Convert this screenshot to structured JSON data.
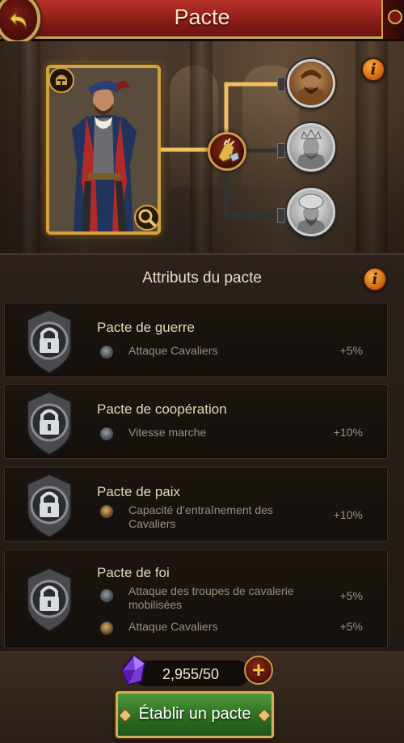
{
  "header": {
    "title": "Pacte"
  },
  "section": {
    "title": "Attributs du pacte"
  },
  "pacts": [
    {
      "name": "Pacte de guerre",
      "bonuses": [
        {
          "icon": "knight-helmet-icon",
          "label": "Attaque Cavaliers",
          "value": "+5%"
        }
      ]
    },
    {
      "name": "Pacte de coopération",
      "bonuses": [
        {
          "icon": "knight-helmet-icon",
          "label": "Vitesse marche",
          "value": "+10%"
        }
      ]
    },
    {
      "name": "Pacte de paix",
      "bonuses": [
        {
          "icon": "cavalry-training-icon",
          "label": "Capacité d’entraînement des Cavaliers",
          "value": "+10%"
        }
      ]
    },
    {
      "name": "Pacte de foi",
      "bonuses": [
        {
          "icon": "knight-helmet-icon",
          "label": "Attaque des troupes de cavalerie mobilisées",
          "value": "+5%"
        },
        {
          "icon": "cavalry-training-icon",
          "label": "Attaque Cavaliers",
          "value": "+5%"
        }
      ]
    }
  ],
  "cost": {
    "value": "2,955/50",
    "icon": "purple-crystal-icon"
  },
  "actions": {
    "establish_label": "Établir un pacte"
  },
  "colors": {
    "header_red": "#8c1d18",
    "gold_border": "#d4a13e",
    "button_green": "#2f7224",
    "info_orange": "#e07a16"
  }
}
